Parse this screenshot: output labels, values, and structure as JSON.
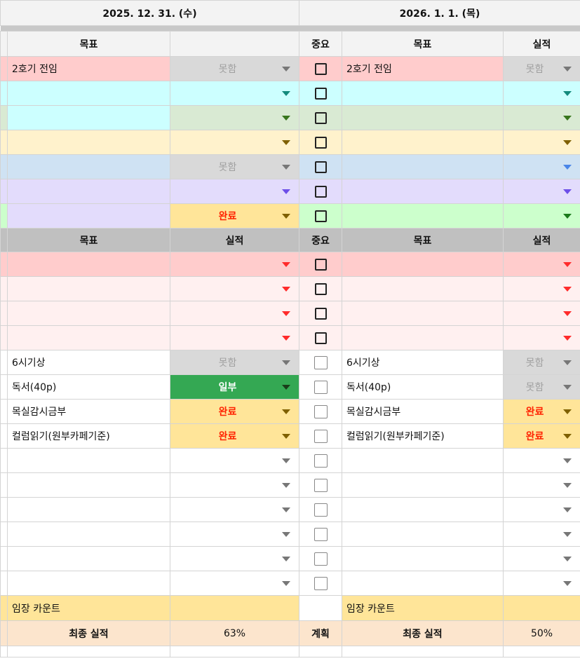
{
  "dates": {
    "left": "2025. 12. 31. (수)",
    "right": "2026. 1. 1. (목)"
  },
  "headers": {
    "goal": "목표",
    "result": "실적",
    "important": "중요",
    "left_result_top": ""
  },
  "colors": {
    "none_bg": "#d9d9d9",
    "done_bg": "#ffe599",
    "part_bg": "#34a853"
  },
  "sections": [
    {
      "rows": [
        {
          "bg": "#ffcccc",
          "lgoal_bg": "#ffcccc",
          "lgoal": "2호기 전임",
          "lres": "못함",
          "lres_type": "none",
          "larrow": "#777777",
          "rgoal": "2호기 전임",
          "rres": "못함",
          "rres_type": "none",
          "rarrow": "#777777",
          "check": "bold"
        },
        {
          "bg": "#ccffff",
          "lgoal_bg": "#ccffff",
          "lgoal": "",
          "lres": "",
          "lres_type": "",
          "larrow": "#138a7c",
          "rgoal": "",
          "rres": "",
          "rres_type": "",
          "rarrow": "#138a7c",
          "check": "bold"
        },
        {
          "bg": "#d9ead3",
          "lgoal_bg": "#ccffff",
          "lgoal": "",
          "lres": "",
          "lres_type": "",
          "larrow": "#38761d",
          "rgoal": "",
          "rres": "",
          "rres_type": "",
          "rarrow": "#38761d",
          "check": "bold"
        },
        {
          "bg": "#fff2cc",
          "lgoal_bg": "#fff2cc",
          "lgoal": "",
          "lres": "",
          "lres_type": "",
          "larrow": "#7f6000",
          "rgoal": "",
          "rres": "",
          "rres_type": "",
          "rarrow": "#7f6000",
          "check": "bold"
        },
        {
          "bg": "#cfe2f3",
          "lgoal_bg": "#cfe2f3",
          "lgoal": "",
          "lres": "못함",
          "lres_type": "none",
          "larrow": "#777777",
          "rgoal": "",
          "rres": "",
          "rres_type": "",
          "rarrow": "#4a86e8",
          "check": "bold"
        },
        {
          "bg": "#e3dcfc",
          "lgoal_bg": "#e3dcfc",
          "lgoal": "",
          "lres": "",
          "lres_type": "",
          "larrow": "#6d4fe8",
          "rgoal": "",
          "rres": "",
          "rres_type": "",
          "rarrow": "#6d4fe8",
          "check": "bold"
        },
        {
          "bg": "#ccffcc",
          "lgoal_bg": "#e3dcfc",
          "lgoal": "",
          "lres": "완료",
          "lres_type": "done",
          "larrow": "#7f6000",
          "rgoal": "",
          "rres": "",
          "rres_type": "",
          "rarrow": "#1c7a1c",
          "check": "bold"
        }
      ]
    },
    {
      "rows": [
        {
          "bg": "#ffcccc",
          "lgoal_bg": "#ffcccc",
          "lgoal": "",
          "lres": "",
          "lres_type": "",
          "larrow": "#ff2b2b",
          "rgoal": "",
          "rres": "",
          "rres_type": "",
          "rarrow": "#ff2b2b",
          "check": "bold"
        },
        {
          "bg": "#fff0f0",
          "lgoal_bg": "#fff0f0",
          "lgoal": "",
          "lres": "",
          "lres_type": "",
          "larrow": "#ff2b2b",
          "rgoal": "",
          "rres": "",
          "rres_type": "",
          "rarrow": "#ff2b2b",
          "check": "bold"
        },
        {
          "bg": "#fff0f0",
          "lgoal_bg": "#fff0f0",
          "lgoal": "",
          "lres": "",
          "lres_type": "",
          "larrow": "#ff2b2b",
          "rgoal": "",
          "rres": "",
          "rres_type": "",
          "rarrow": "#ff2b2b",
          "check": "bold"
        },
        {
          "bg": "#fff0f0",
          "lgoal_bg": "#fff0f0",
          "lgoal": "",
          "lres": "",
          "lres_type": "",
          "larrow": "#ff2b2b",
          "rgoal": "",
          "rres": "",
          "rres_type": "",
          "rarrow": "#ff2b2b",
          "check": "bold"
        },
        {
          "bg": "#ffffff",
          "lgoal_bg": "#ffffff",
          "lgoal": "6시기상",
          "lres": "못함",
          "lres_type": "none",
          "larrow": "#777777",
          "rgoal": "6시기상",
          "rres": "못함",
          "rres_type": "none",
          "rarrow": "#777777",
          "check": "light"
        },
        {
          "bg": "#ffffff",
          "lgoal_bg": "#ffffff",
          "lgoal": "독서(40p)",
          "lres": "일부",
          "lres_type": "part",
          "larrow": "#1a3d1a",
          "rgoal": "독서(40p)",
          "rres": "못함",
          "rres_type": "none",
          "rarrow": "#777777",
          "check": "light"
        },
        {
          "bg": "#ffffff",
          "lgoal_bg": "#ffffff",
          "lgoal": "목실감시금부",
          "lres": "완료",
          "lres_type": "done",
          "larrow": "#7f6000",
          "rgoal": "목실감시금부",
          "rres": "완료",
          "rres_type": "done",
          "rarrow": "#7f6000",
          "check": "light"
        },
        {
          "bg": "#ffffff",
          "lgoal_bg": "#ffffff",
          "lgoal": "컬럼읽기(원부카페기준)",
          "lres": "완료",
          "lres_type": "done",
          "larrow": "#7f6000",
          "rgoal": "컬럼읽기(원부카페기준)",
          "rres": "완료",
          "rres_type": "done",
          "rarrow": "#7f6000",
          "check": "light"
        },
        {
          "bg": "#ffffff",
          "lgoal_bg": "#ffffff",
          "lgoal": "",
          "lres": "",
          "lres_type": "",
          "larrow": "#777777",
          "rgoal": "",
          "rres": "",
          "rres_type": "",
          "rarrow": "#777777",
          "check": "light"
        },
        {
          "bg": "#ffffff",
          "lgoal_bg": "#ffffff",
          "lgoal": "",
          "lres": "",
          "lres_type": "",
          "larrow": "#777777",
          "rgoal": "",
          "rres": "",
          "rres_type": "",
          "rarrow": "#777777",
          "check": "light"
        },
        {
          "bg": "#ffffff",
          "lgoal_bg": "#ffffff",
          "lgoal": "",
          "lres": "",
          "lres_type": "",
          "larrow": "#777777",
          "rgoal": "",
          "rres": "",
          "rres_type": "",
          "rarrow": "#777777",
          "check": "light"
        },
        {
          "bg": "#ffffff",
          "lgoal_bg": "#ffffff",
          "lgoal": "",
          "lres": "",
          "lres_type": "",
          "larrow": "#777777",
          "rgoal": "",
          "rres": "",
          "rres_type": "",
          "rarrow": "#777777",
          "check": "light"
        },
        {
          "bg": "#ffffff",
          "lgoal_bg": "#ffffff",
          "lgoal": "",
          "lres": "",
          "lres_type": "",
          "larrow": "#777777",
          "rgoal": "",
          "rres": "",
          "rres_type": "",
          "rarrow": "#777777",
          "check": "light"
        },
        {
          "bg": "#ffffff",
          "lgoal_bg": "#ffffff",
          "lgoal": "",
          "lres": "",
          "lres_type": "",
          "larrow": "#777777",
          "rgoal": "",
          "rres": "",
          "rres_type": "",
          "rarrow": "#777777",
          "check": "light"
        }
      ]
    }
  ],
  "footer": {
    "count_label": "임장 카운트",
    "final_label": "최종 실적",
    "left_final": "63%",
    "plan_label": "계획",
    "right_final": "50%"
  }
}
